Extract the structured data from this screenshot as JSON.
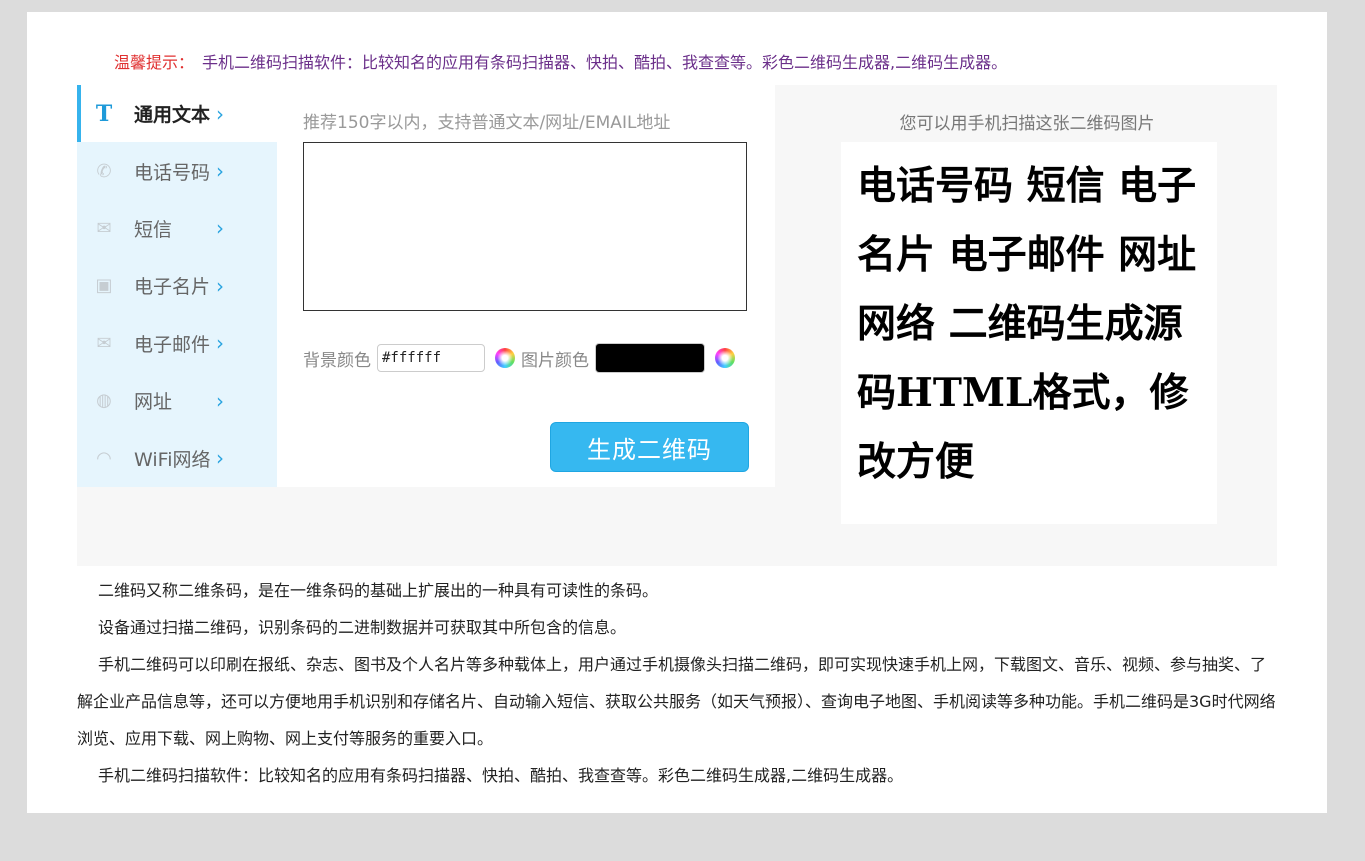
{
  "tip": {
    "label": "温馨提示：",
    "text": "手机二维码扫描软件：比较知名的应用有条码扫描器、快拍、酷拍、我查查等。彩色二维码生成器,二维码生成器。"
  },
  "sidebar": {
    "items": [
      {
        "label": "通用文本",
        "icon": "T",
        "icon_name": "text-icon",
        "active": true
      },
      {
        "label": "电话号码",
        "icon": "✆",
        "icon_name": "phone-icon",
        "active": false
      },
      {
        "label": "短信",
        "icon": "✉",
        "icon_name": "sms-icon",
        "active": false
      },
      {
        "label": "电子名片",
        "icon": "▣",
        "icon_name": "vcard-icon",
        "active": false
      },
      {
        "label": "电子邮件",
        "icon": "✉",
        "icon_name": "email-icon",
        "active": false
      },
      {
        "label": "网址",
        "icon": "◍",
        "icon_name": "globe-icon",
        "active": false
      },
      {
        "label": "WiFi网络",
        "icon": "◠",
        "icon_name": "wifi-icon",
        "active": false
      }
    ],
    "chevron": "›"
  },
  "form": {
    "hint": "推荐150字以内，支持普通文本/网址/EMAIL地址",
    "textarea_value": "",
    "bg_color_label": "背景颜色",
    "bg_color_value": "#ffffff",
    "img_color_label": "图片颜色",
    "img_color_value": "#000000",
    "generate_label": "生成二维码"
  },
  "preview": {
    "caption": "您可以用手机扫描这张二维码图片",
    "text": "电话号码 短信 电子名片 电子邮件 网址 网络 二维码生成源码HTML格式，修改方便"
  },
  "description": [
    "二维码又称二维条码，是在一维条码的基础上扩展出的一种具有可读性的条码。",
    "设备通过扫描二维码，识别条码的二进制数据并可获取其中所包含的信息。",
    "手机二维码可以印刷在报纸、杂志、图书及个人名片等多种载体上，用户通过手机摄像头扫描二维码，即可实现快速手机上网，下载图文、音乐、视频、参与抽奖、了解企业产品信息等，还可以方便地用手机识别和存储名片、自动输入短信、获取公共服务（如天气预报）、查询电子地图、手机阅读等多种功能。手机二维码是3G时代网络浏览、应用下载、网上购物、网上支付等服务的重要入口。",
    "手机二维码扫描软件：比较知名的应用有条码扫描器、快拍、酷拍、我查查等。彩色二维码生成器,二维码生成器。"
  ],
  "colors": {
    "accent": "#36b8f0",
    "sidebar_bg": "#e6f5fd",
    "tip_label": "#e03030",
    "tip_text": "#6b2f8a"
  }
}
